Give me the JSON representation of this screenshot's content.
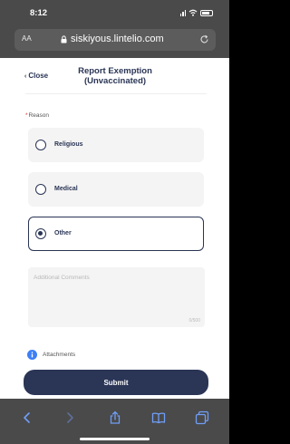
{
  "status_bar": {
    "time": "8:12"
  },
  "browser": {
    "text_size_label": "AA",
    "url": "siskiyous.lintelio.com"
  },
  "header": {
    "close_label": "Close",
    "title_line1": "Report Exemption",
    "title_line2": "(Unvaccinated)"
  },
  "form": {
    "reason_label": "Reason",
    "options": [
      {
        "label": "Religious",
        "selected": false
      },
      {
        "label": "Medical",
        "selected": false
      },
      {
        "label": "Other",
        "selected": true
      }
    ],
    "comments_placeholder": "Additional Comments",
    "comments_value": "",
    "char_count": "0/500",
    "attachments_label": "Attachments",
    "submit_label": "Submit"
  },
  "colors": {
    "primary": "#2b3556",
    "chrome": "#4a4a4a",
    "option_bg": "#f4f4f4",
    "accent_blue": "#3d7ff5"
  },
  "icons": {
    "toolbar": [
      "back-icon",
      "forward-icon",
      "share-icon",
      "bookmarks-icon",
      "tabs-icon"
    ],
    "attachment": "info-icon"
  }
}
